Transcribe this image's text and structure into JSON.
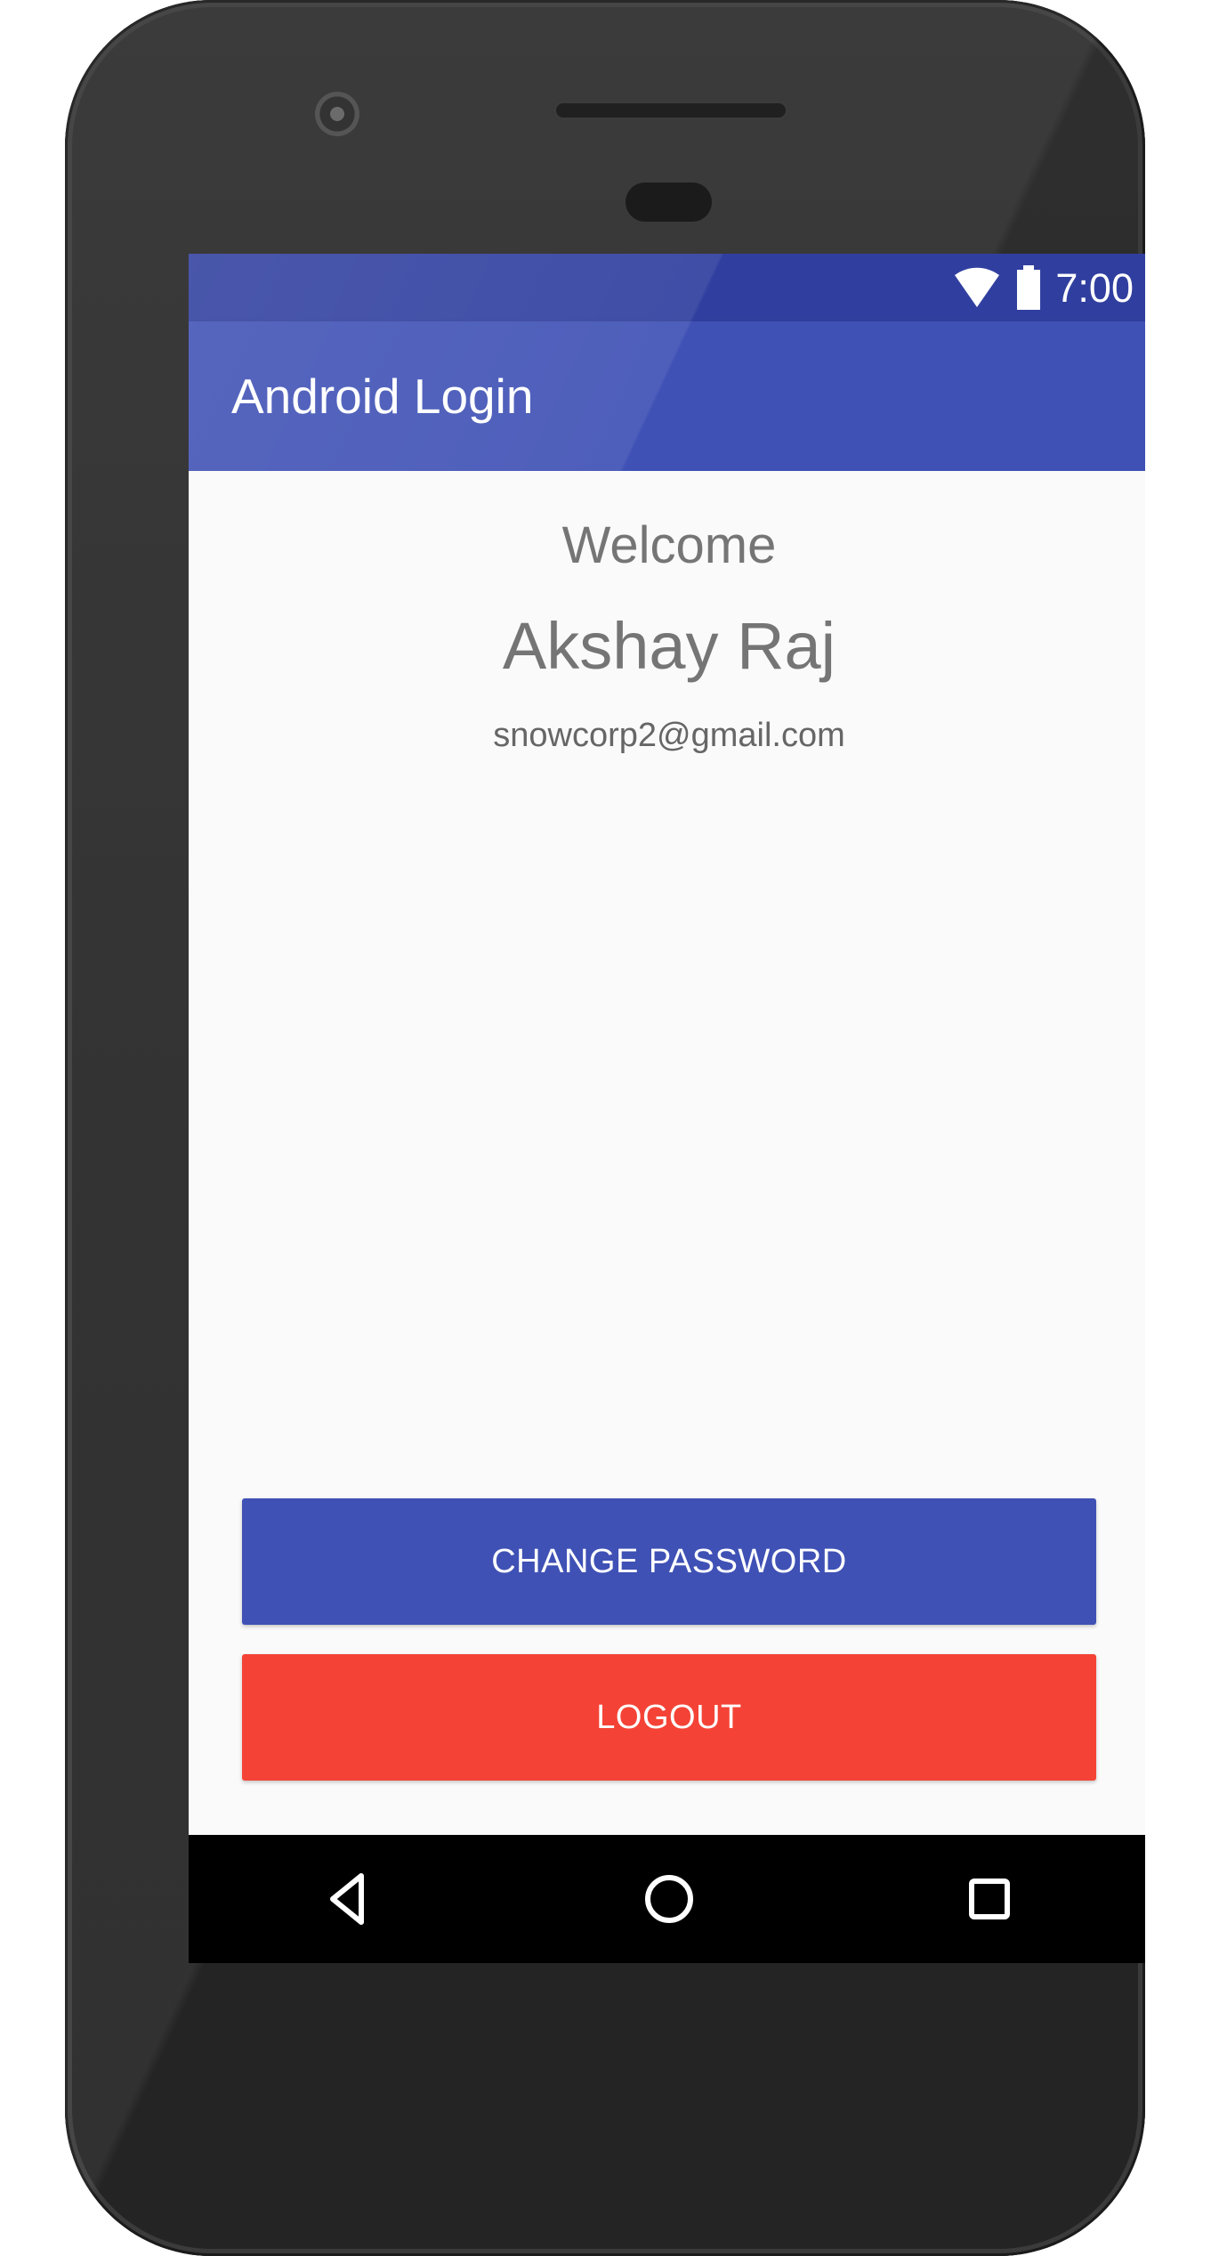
{
  "status_bar": {
    "time": "7:00",
    "icons": [
      "wifi-icon",
      "battery-icon"
    ]
  },
  "app_bar": {
    "title": "Android Login"
  },
  "profile": {
    "welcome_text": "Welcome",
    "name": "Akshay Raj",
    "email": "snowcorp2@gmail.com"
  },
  "buttons": {
    "change_password": "CHANGE PASSWORD",
    "logout": "LOGOUT"
  },
  "navigation": {
    "back_icon": "back-icon",
    "home_icon": "home-icon",
    "recents_icon": "recents-icon"
  },
  "colors": {
    "primary": "#3f51b5",
    "primary_dark": "#303f9f",
    "logout": "#f44336",
    "background": "#fafafa",
    "text_secondary": "#757575"
  }
}
